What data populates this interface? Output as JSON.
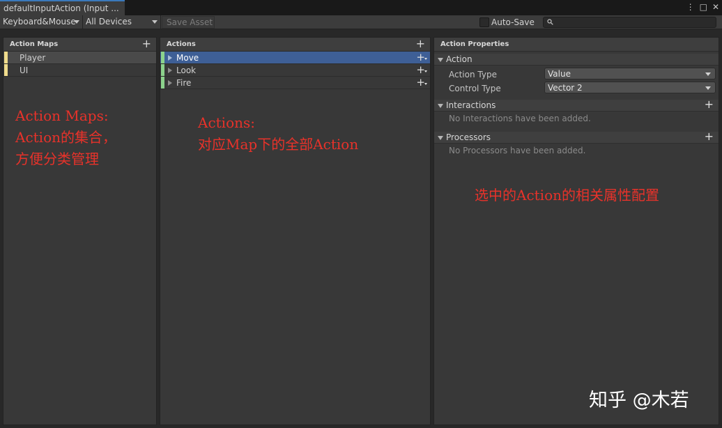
{
  "tab": {
    "title": "defaultInputAction (Input ..."
  },
  "window": {
    "menu_icon": "kebab-menu-icon",
    "maximize_icon": "maximize-icon",
    "close_icon": "close-icon"
  },
  "toolbar": {
    "control_scheme": "Keyboard&Mouse",
    "devices": "All Devices",
    "save_asset": "Save Asset",
    "auto_save_label": "Auto-Save",
    "auto_save_checked": false,
    "search_placeholder": ""
  },
  "action_maps": {
    "header": "Action Maps",
    "items": [
      {
        "label": "Player",
        "color": "#f0dc8c",
        "selected": true
      },
      {
        "label": "UI",
        "color": "#f0dc8c",
        "selected": false
      }
    ]
  },
  "actions": {
    "header": "Actions",
    "items": [
      {
        "label": "Move",
        "color": "#8cd28c",
        "selected": true
      },
      {
        "label": "Look",
        "color": "#8cd28c",
        "selected": false
      },
      {
        "label": "Fire",
        "color": "#8cd28c",
        "selected": false
      }
    ]
  },
  "properties": {
    "header": "Action Properties",
    "action_section": "Action",
    "action_type_label": "Action Type",
    "action_type_value": "Value",
    "control_type_label": "Control Type",
    "control_type_value": "Vector 2",
    "interactions_section": "Interactions",
    "interactions_empty": "No Interactions have been added.",
    "processors_section": "Processors",
    "processors_empty": "No Processors have been added."
  },
  "annotations": {
    "maps_line1": "Action Maps:",
    "maps_line2": "Action的集合，",
    "maps_line3": "方便分类管理",
    "actions_line1": "Actions:",
    "actions_line2": "对应Map下的全部Action",
    "props_line1": "选中的Action的相关属性配置"
  },
  "watermark": "知乎 @木若"
}
